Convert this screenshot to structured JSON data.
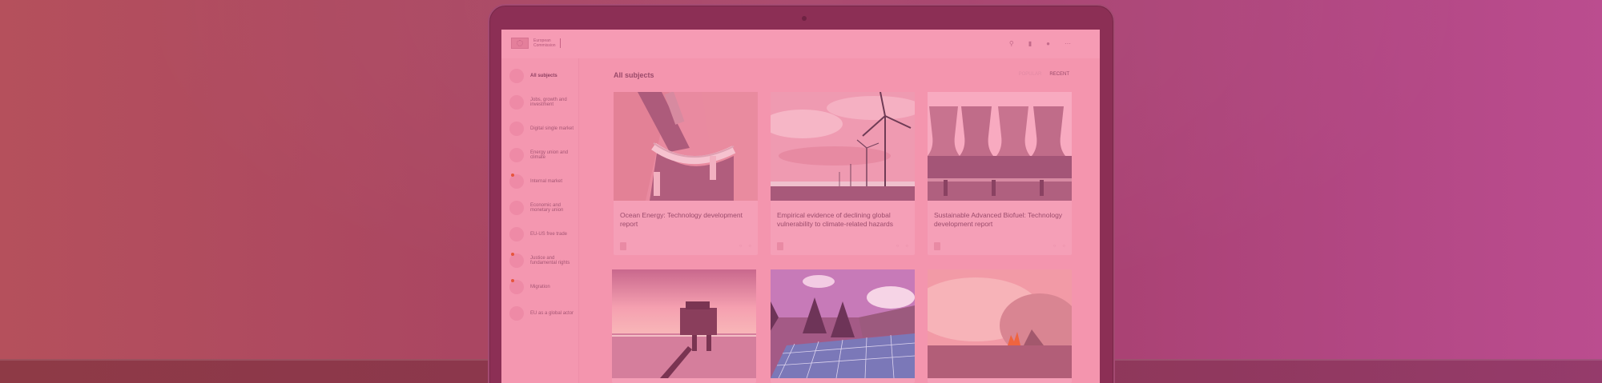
{
  "branding": {
    "logo_text": "European Commission"
  },
  "topbar_icons": [
    "search-icon",
    "bookmark-icon",
    "user-icon",
    "more-icon"
  ],
  "sidebar": {
    "items": [
      {
        "label": "All subjects",
        "active": true,
        "alert": false
      },
      {
        "label": "Jobs, growth and investment",
        "active": false,
        "alert": false
      },
      {
        "label": "Digital single market",
        "active": false,
        "alert": false
      },
      {
        "label": "Energy union and climate",
        "active": false,
        "alert": false
      },
      {
        "label": "Internal market",
        "active": false,
        "alert": true
      },
      {
        "label": "Economic and monetary union",
        "active": false,
        "alert": false
      },
      {
        "label": "EU-US free trade",
        "active": false,
        "alert": false
      },
      {
        "label": "Justice and fundamental rights",
        "active": false,
        "alert": true
      },
      {
        "label": "Migration",
        "active": false,
        "alert": true
      },
      {
        "label": "EU as a global actor",
        "active": false,
        "alert": false
      }
    ]
  },
  "main": {
    "title": "All subjects",
    "sort": {
      "popular": "POPULAR",
      "recent": "RECENT",
      "active": "recent"
    },
    "cards": [
      {
        "title": "Ocean Energy: Technology development report",
        "image": "dam"
      },
      {
        "title": "Empirical evidence of declining global vulnerability to climate-related hazards",
        "image": "wind-turbines"
      },
      {
        "title": "Sustainable Advanced Biofuel: Technology development report",
        "image": "cooling-towers"
      },
      {
        "title": "",
        "image": "oil-rig"
      },
      {
        "title": "",
        "image": "solar-panels"
      },
      {
        "title": "",
        "image": "wildfire"
      }
    ]
  },
  "colors": {
    "background": "#a84463",
    "screen_overlay": "#f495ae",
    "accent_alert": "#e6553d"
  }
}
